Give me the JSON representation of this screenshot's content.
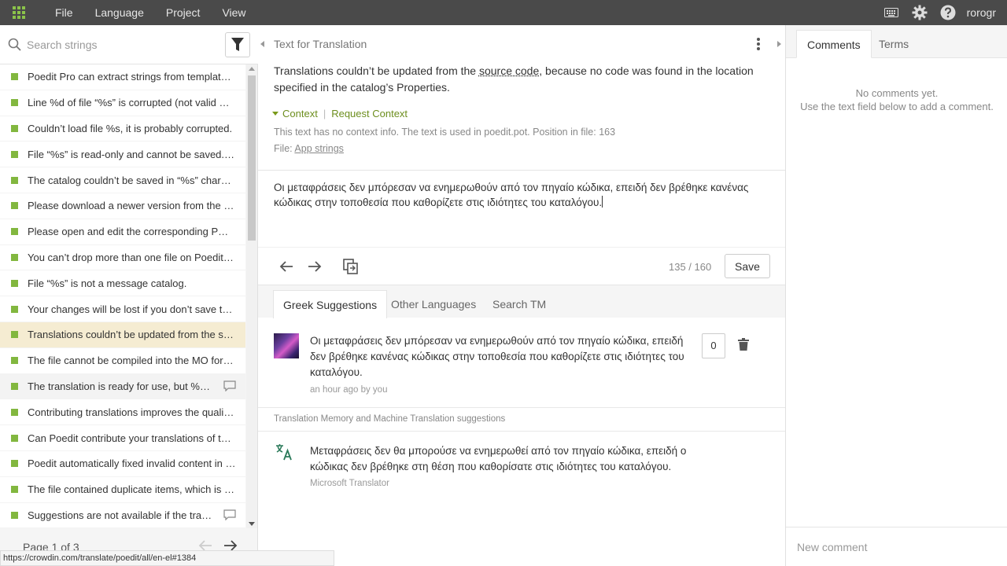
{
  "topbar": {
    "menu": [
      "File",
      "Language",
      "Project",
      "View"
    ],
    "username": "rorogr"
  },
  "left": {
    "search_placeholder": "Search strings",
    "strings": [
      "Poedit Pro can extract strings from template files",
      "Line %d of file “%s” is corrupted (not valid %s data).",
      "Couldn’t load file %s, it is probably corrupted.",
      "File “%s” is read-only and cannot be saved.\\nPlease save it under a different name.",
      "The catalog couldn’t be saved in “%s” charset as specified in catalog settings.",
      "Please download a newer version from the Poedit website.",
      "Please open and edit the corresponding PO file instead.",
      "You can’t drop more than one file on Poedit window.",
      "File “%s” is not a message catalog.",
      "Your changes will be lost if you don’t save them.",
      "Translations couldn’t be updated from the source code",
      "The file cannot be compiled into the MO format.",
      "The translation is ready for use, but %d entries were not compiled",
      "Contributing translations improves the quality of the translation memory",
      "Can Poedit contribute your translations of this file to the community?",
      "Poedit automatically fixed invalid content in the file",
      "The file contained duplicate items, which is not allowed",
      "Suggestions are not available if the translation language is not set"
    ],
    "page_label": "Page 1 of 3",
    "status_url": "https://crowdin.com/translate/poedit/all/en-el#1384"
  },
  "middle": {
    "source_header": "Text for Translation",
    "source_text_before": "Translations couldn’t be updated from the ",
    "source_text_link": "source code",
    "source_text_after": ", because no code was found in the location specified in the catalog’s Properties.",
    "context_label": "Context",
    "request_context": "Request Context",
    "context_info": "This text has no context info. The text is used in poedit.pot. Position in file: 163",
    "file_label": "File: ",
    "file_link": "App strings",
    "translation_text": "Οι μεταφράσεις δεν μπόρεσαν να ενημερωθούν από τον πηγαίο κώδικα, επειδή δεν βρέθηκε κανένας κώδικας στην τοποθεσία που καθορίζετε στις ιδιότητες του καταλόγου.",
    "counter": "135 / 160",
    "save_label": "Save",
    "tabs": [
      "Greek Suggestions",
      "Other Languages",
      "Search TM"
    ],
    "suggestion": {
      "text": "Οι μεταφράσεις δεν μπόρεσαν να ενημερωθούν από τον πηγαίο κώδικα, επειδή δεν βρέθηκε κανένας κώδικας στην τοποθεσία που καθορίζετε στις ιδιότητες του καταλόγου.",
      "meta": "an hour ago by you",
      "votes": "0"
    },
    "tm_header": "Translation Memory and Machine Translation suggestions",
    "mt_suggestion": {
      "text": "Μεταφράσεις δεν θα μπορούσε να ενημερωθεί από τον πηγαίο κώδικα, επειδή ο κώδικας δεν βρέθηκε στη θέση που καθορίσατε στις ιδιότητες του καταλόγου.",
      "source": "Microsoft Translator"
    }
  },
  "right": {
    "tabs": [
      "Comments",
      "Terms"
    ],
    "no_comments_1": "No comments yet.",
    "no_comments_2": "Use the text field below to add a comment.",
    "new_comment_placeholder": "New comment"
  },
  "colors": {
    "topbar": "#4a4a4a",
    "status_green": "#82b73f",
    "active_row": "#f5ecd2",
    "context_green": "#6d8e1e"
  }
}
